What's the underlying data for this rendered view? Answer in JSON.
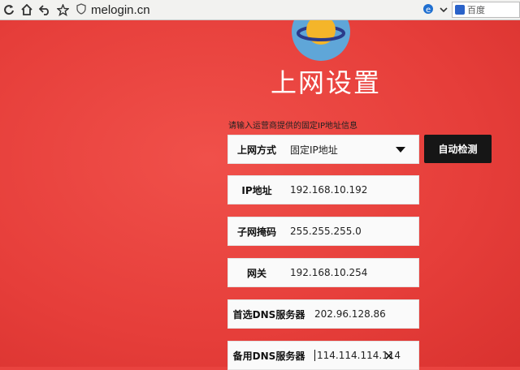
{
  "browser": {
    "url": "melogin.cn",
    "search_engine": "百度",
    "nav_icons": [
      "refresh-icon",
      "home-icon",
      "back-icon",
      "star-icon"
    ]
  },
  "page": {
    "title": "上网设置",
    "hint": "请输入运营商提供的固定IP地址信息",
    "connection_type": {
      "label": "上网方式",
      "value": "固定IP地址"
    },
    "detect_button": "自动检测",
    "ip_address": {
      "label": "IP地址",
      "value": "192.168.10.192"
    },
    "subnet_mask": {
      "label": "子网掩码",
      "value": "255.255.255.0"
    },
    "gateway": {
      "label": "网关",
      "value": "192.168.10.254"
    },
    "primary_dns": {
      "label": "首选DNS服务器",
      "value": "202.96.128.86"
    },
    "secondary_dns": {
      "label": "备用DNS服务器",
      "value": "114.114.114.114"
    }
  },
  "colors": {
    "background": "#e9433f",
    "button": "#161616",
    "field": "#fafafa"
  }
}
